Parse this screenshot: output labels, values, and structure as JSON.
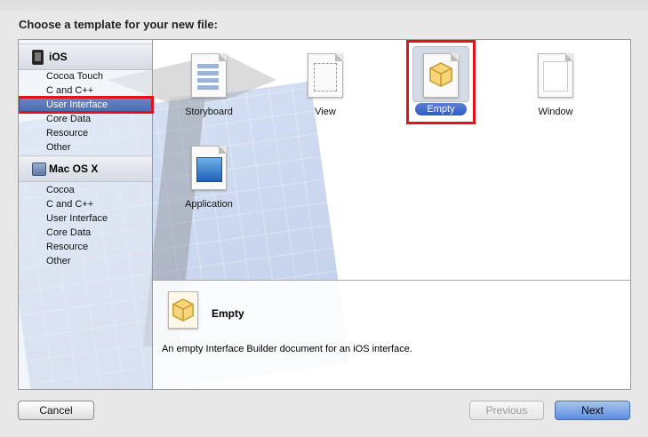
{
  "dialog": {
    "title": "Choose a template for your new file:"
  },
  "sidebar": {
    "groups": [
      {
        "label": "iOS",
        "icon": "iphone-icon",
        "items": [
          "Cocoa Touch",
          "C and C++",
          "User Interface",
          "Core Data",
          "Resource",
          "Other"
        ]
      },
      {
        "label": "Mac OS X",
        "icon": "mac-icon",
        "items": [
          "Cocoa",
          "C and C++",
          "User Interface",
          "Core Data",
          "Resource",
          "Other"
        ]
      }
    ],
    "selected": "User Interface"
  },
  "templates": {
    "storyboard": "Storyboard",
    "view": "View",
    "empty": "Empty",
    "window": "Window",
    "application": "Application"
  },
  "detail": {
    "title": "Empty",
    "description": "An empty Interface Builder document for an iOS interface."
  },
  "buttons": {
    "cancel": "Cancel",
    "previous": "Previous",
    "next": "Next"
  },
  "colors": {
    "selection_highlight": "#4c6bb0",
    "annotation_red": "#e0141b",
    "primary_button": "#5b8ee0"
  }
}
